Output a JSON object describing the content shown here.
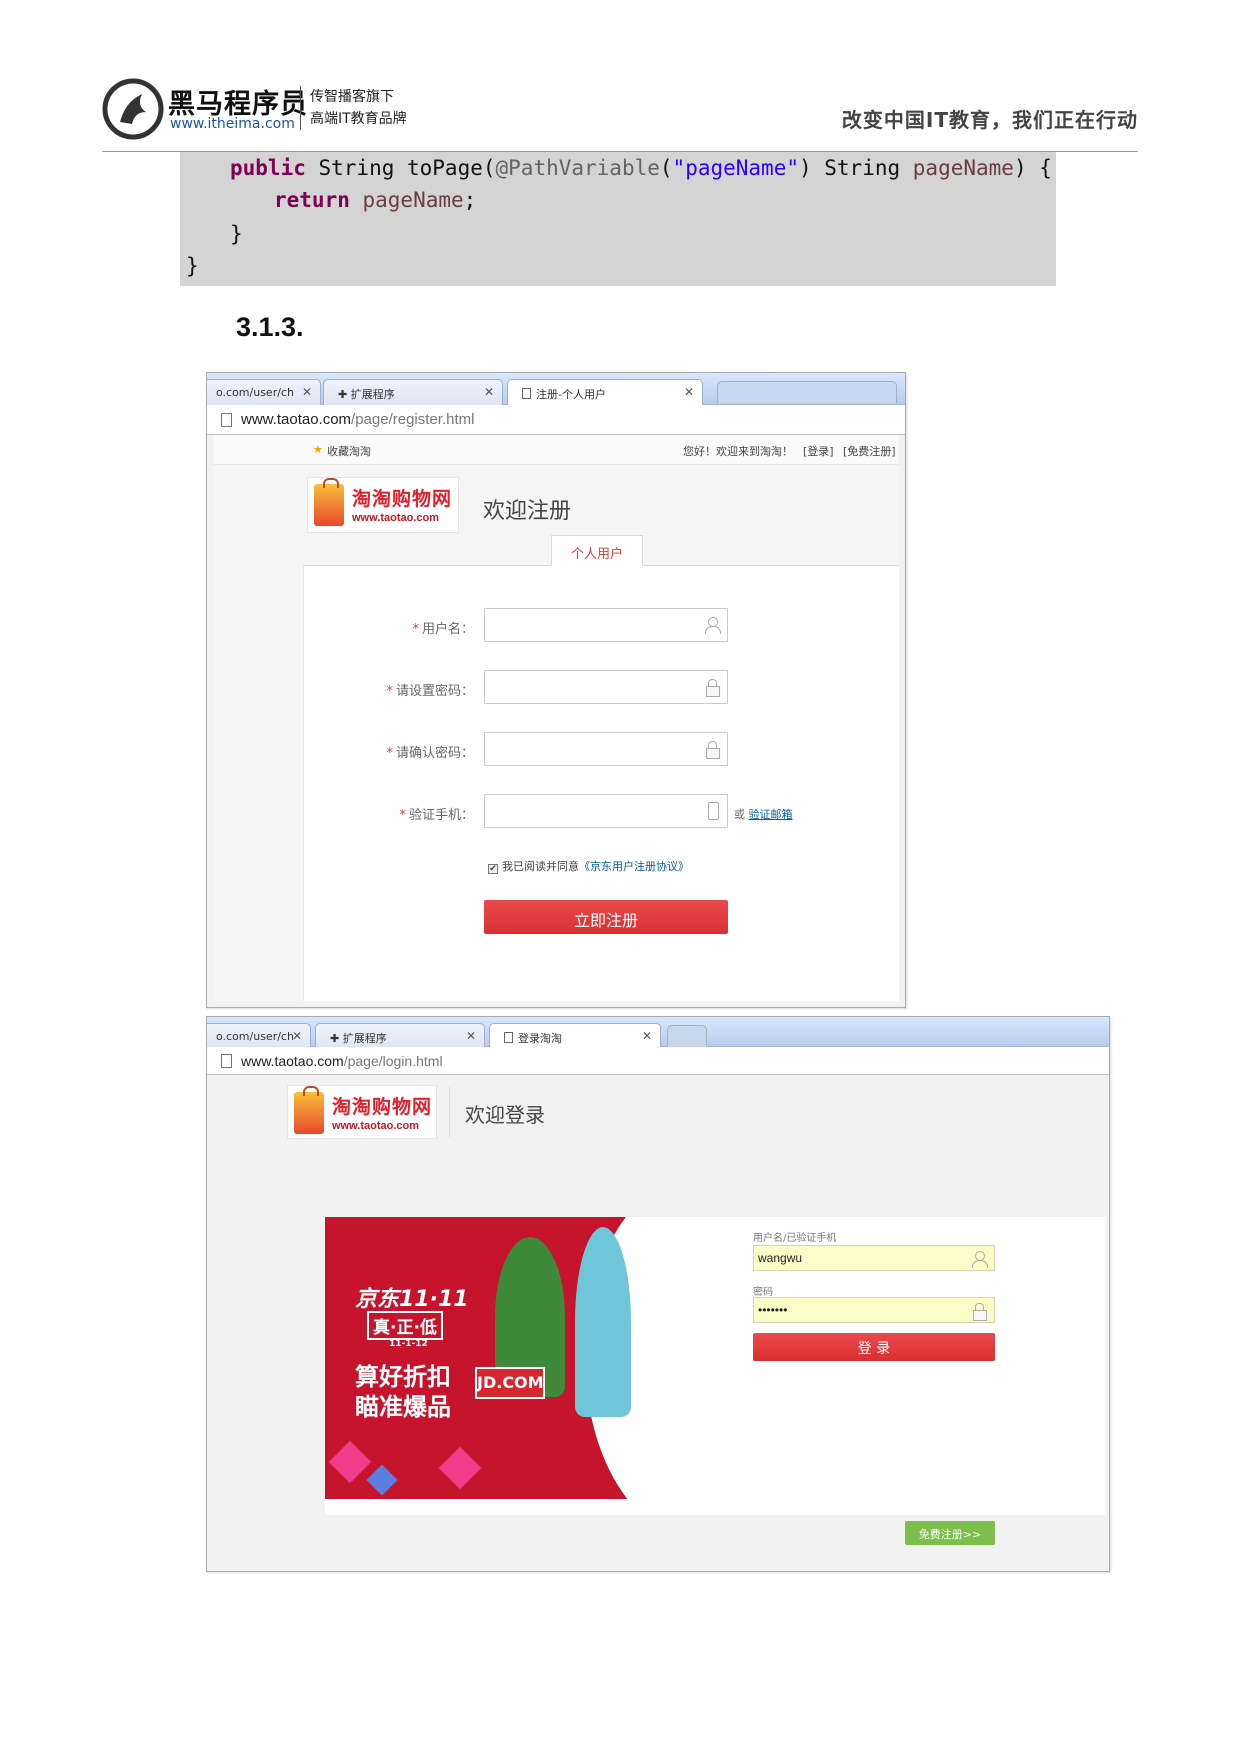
{
  "doc_header": {
    "brand_name": "黑马程序员",
    "brand_url": "www.itheima.com",
    "tagline_1": "传智播客旗下",
    "tagline_2": "高端IT教育品牌",
    "slogan": "改变中国IT教育，我们正在行动"
  },
  "code": {
    "line1_kw": "public",
    "line1_a": " String toPage(",
    "line1_ann": "@PathVariable",
    "line1_b": "(",
    "line1_str": "\"pageName\"",
    "line1_c": ") String ",
    "line1_var": "pageName",
    "line1_d": ") {",
    "line2_kw": "return",
    "line2_var": " pageName",
    "line2_end": ";",
    "line3": "}",
    "line4": "}"
  },
  "section_number": "3.1.3.",
  "register": {
    "tabs": [
      {
        "label": "o.com/user/ch"
      },
      {
        "label": "扩展程序"
      },
      {
        "label": "注册-个人用户"
      }
    ],
    "url_host": "www.taotao.com",
    "url_path": "/page/register.html",
    "bookmark": "收藏淘淘",
    "greeting": "您好！欢迎来到淘淘！",
    "login_link": "[登录]",
    "register_link": "[免费注册]",
    "logo_name": "淘淘购物网",
    "logo_url": "www.taotao.com",
    "welcome": "欢迎注册",
    "tab_personal": "个人用户",
    "fields": [
      {
        "label": "用户名："
      },
      {
        "label": "请设置密码："
      },
      {
        "label": "请确认密码："
      },
      {
        "label": "验证手机："
      }
    ],
    "required_mark": "*",
    "alt_or": "或 ",
    "alt_email": "验证邮箱",
    "agree_text": "我已阅读并同意",
    "agree_link": "《京东用户注册协议》",
    "checkmark": "✔",
    "submit": "立即注册"
  },
  "login": {
    "tabs": [
      {
        "label": "o.com/user/ch"
      },
      {
        "label": "扩展程序"
      },
      {
        "label": "登录淘淘"
      }
    ],
    "url_host": "www.taotao.com",
    "url_path": "/page/login.html",
    "logo_name": "淘淘购物网",
    "logo_url": "www.taotao.com",
    "welcome": "欢迎登录",
    "banner_line1": "京东11·11",
    "banner_line2": "真·正·低",
    "banner_line3": "11-1-12",
    "banner_line4": "算好折扣",
    "banner_line5": "瞄准爆品",
    "banner_logo": "JD.COM",
    "username_label": "用户名/已验证手机",
    "username_value": "wangwu",
    "password_label": "密码",
    "password_value": "•••••••",
    "login_button": "登 录",
    "free_register": "免费注册>>"
  },
  "colors": {
    "accent_red": "#e4393c",
    "link_blue": "#005ea7",
    "green": "#7cbf4b",
    "banner_red": "#c5142b"
  },
  "icons": [
    "horse-logo-icon",
    "document-icon",
    "puzzle-icon",
    "close-icon",
    "star-icon",
    "person-icon",
    "lock-icon",
    "phone-icon",
    "checkbox-icon",
    "shopping-bag-icon"
  ]
}
